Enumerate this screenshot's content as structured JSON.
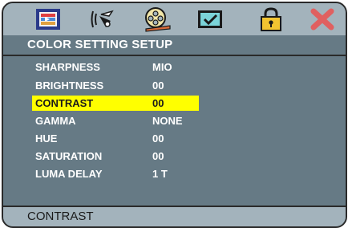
{
  "toolbar": {
    "icons": [
      "picture-settings-icon",
      "audio-settings-icon",
      "video-setup-icon",
      "preferences-icon",
      "password-lock-icon",
      "exit-icon"
    ]
  },
  "section": {
    "title": "COLOR SETTING SETUP"
  },
  "menu": {
    "items": [
      {
        "label": "SHARPNESS",
        "value": "MIO"
      },
      {
        "label": "BRIGHTNESS",
        "value": "00"
      },
      {
        "label": "CONTRAST",
        "value": "00"
      },
      {
        "label": "GAMMA",
        "value": "NONE"
      },
      {
        "label": "HUE",
        "value": "00"
      },
      {
        "label": "SATURATION",
        "value": "00"
      },
      {
        "label": "LUMA DELAY",
        "value": "1 T"
      }
    ],
    "selected": "CONTRAST"
  },
  "status": {
    "text": "CONTRAST"
  },
  "colors": {
    "panel": "#667a85",
    "bar": "#a3b3bc",
    "highlight": "#ffff00",
    "exit": "#e06060"
  }
}
